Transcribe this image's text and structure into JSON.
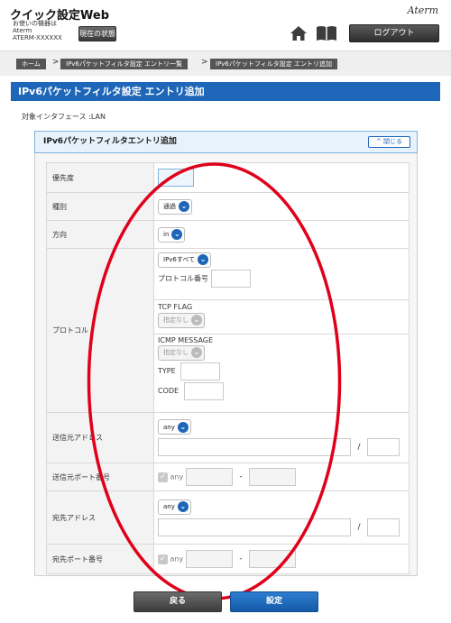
{
  "header": {
    "title": "クイック設定Web",
    "device_line1": "お使いの機器は",
    "device_line2": "Aterm",
    "device_line3": "ATERM-XXXXXX",
    "status_button": "現在の状態",
    "brand": "Aterm",
    "logout_button": "ログアウト"
  },
  "breadcrumb": {
    "items": [
      "ホーム",
      "IPv6パケットフィルタ設定 エントリ一覧",
      "IPv6パケットフィルタ設定 エントリ追加"
    ],
    "separator": ">"
  },
  "page": {
    "title": "IPv6パケットフィルタ設定 エントリ追加",
    "interface_label": "対象インタフェース :LAN"
  },
  "panel": {
    "title": "IPv6パケットフィルタエントリ追加",
    "close_button": "閉じる"
  },
  "form": {
    "priority_label": "優先度",
    "type_label": "種別",
    "type_value": "通過",
    "direction_label": "方向",
    "direction_value": "in",
    "protocol_label": "プロトコル",
    "protocol_value": "IPv6すべて",
    "protocol_number_label": "プロトコル番号",
    "tcp_flag_label": "TCP FLAG",
    "tcp_flag_value": "指定なし",
    "icmp_message_label": "ICMP MESSAGE",
    "icmp_message_value": "指定なし",
    "icmp_type_label": "TYPE",
    "icmp_code_label": "CODE",
    "src_address_label": "送信元アドレス",
    "src_address_value": "any",
    "src_port_label": "送信元ポート番号",
    "src_port_any": "any",
    "dst_address_label": "宛先アドレス",
    "dst_address_value": "any",
    "dst_port_label": "宛先ポート番号",
    "dst_port_any": "any",
    "slash": "/",
    "dash": "-"
  },
  "footer": {
    "back_button": "戻る",
    "set_button": "設定"
  },
  "colors": {
    "accent": "#1e66b8",
    "annotation": "#e0001a"
  },
  "icons": {
    "home": "home-icon",
    "book": "book-icon",
    "dropdown": "chevron-down-icon",
    "close": "chevron-up-icon"
  }
}
